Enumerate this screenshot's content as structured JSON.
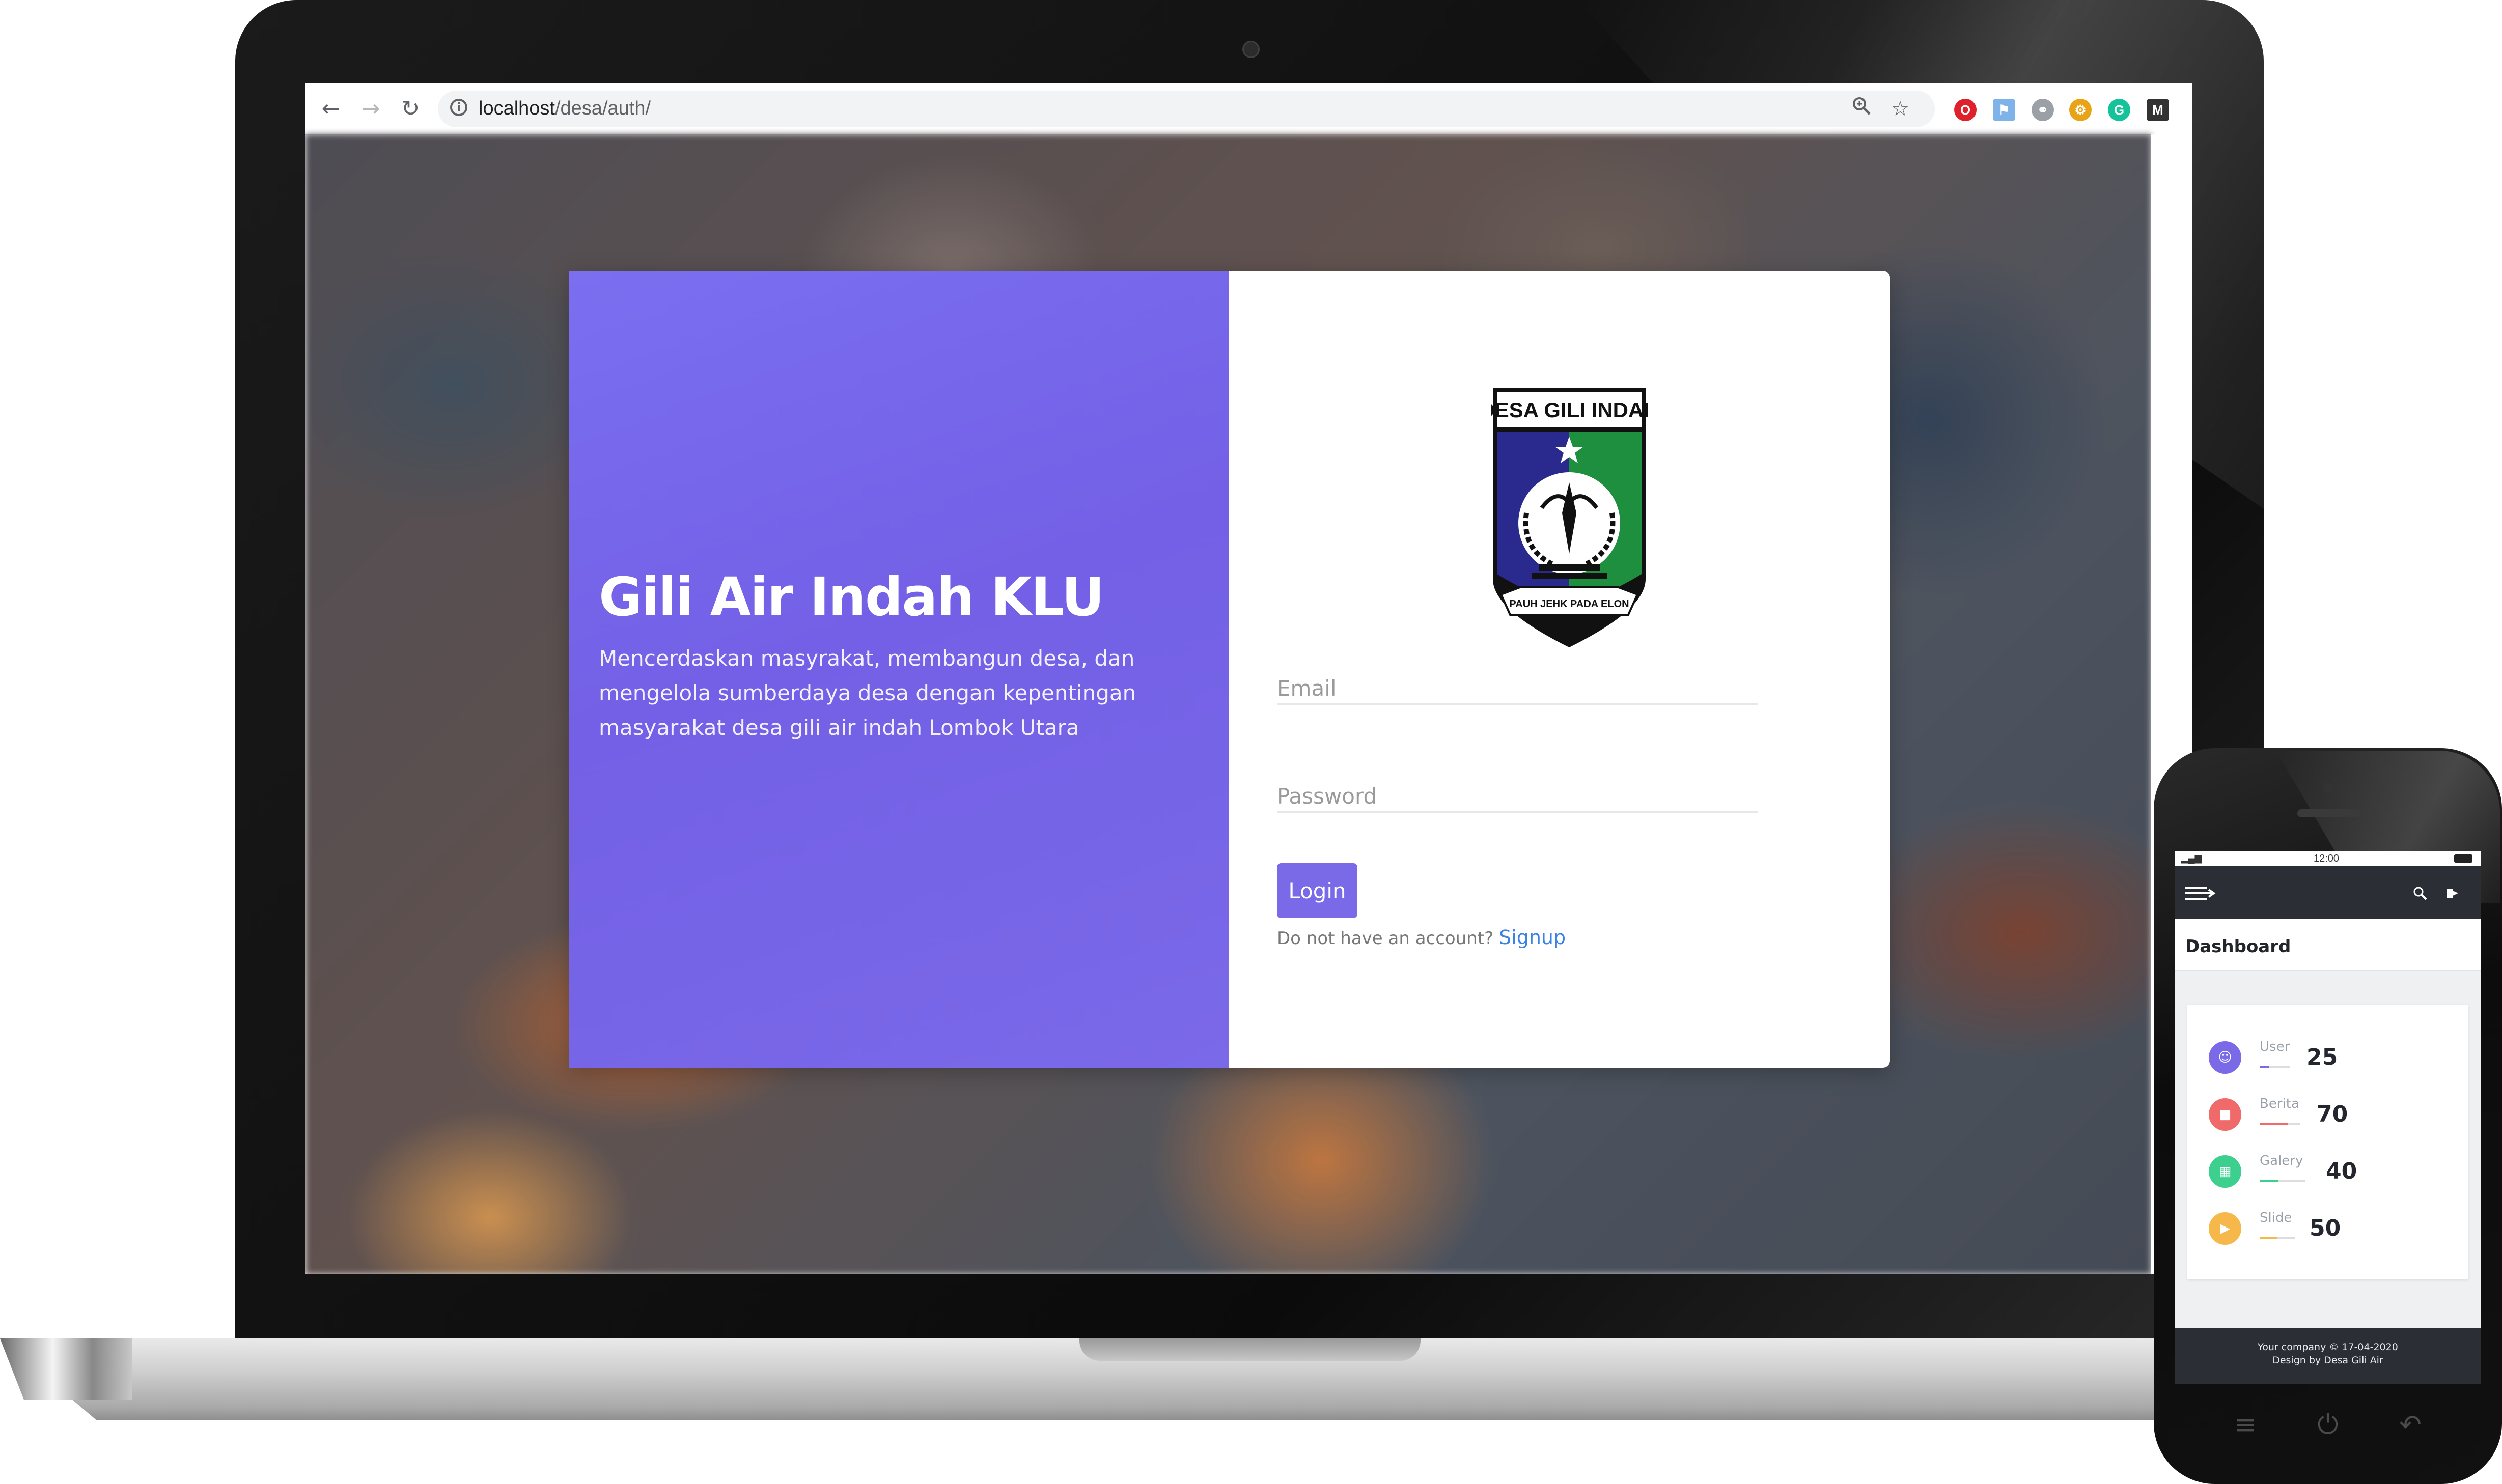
{
  "browser": {
    "url_host": "localhost",
    "url_path": "/desa/auth/",
    "icons": [
      "back-icon",
      "forward-icon",
      "reload-icon",
      "info-icon",
      "zoom-icon",
      "star-icon",
      "menu-dots-icon"
    ]
  },
  "login_page": {
    "title": "Gili Air Indah KLU",
    "description": "Mencerdaskan masyrakat, membangun desa, dan mengelola sumberdaya desa dengan kepentingan masyarakat desa gili air indah Lombok Utara",
    "logo_text": "DESA GILI INDAH",
    "logo_motto": "PAUH JEHK PADA ELON",
    "email_placeholder": "Email",
    "password_placeholder": "Password",
    "login_label": "Login",
    "no_account_text": "Do not have an account?",
    "signup_label": "Signup",
    "colors": {
      "accent": "#7a6ae8",
      "link": "#3b82e6"
    }
  },
  "phone": {
    "status_time": "12:00",
    "dashboard_title": "Dashboard",
    "stats": [
      {
        "label": "User",
        "value": "25",
        "color": "#7a6ae8"
      },
      {
        "label": "Berita",
        "value": "70",
        "color": "#f06a6a"
      },
      {
        "label": "Galery",
        "value": "40",
        "color": "#3ccf8e"
      },
      {
        "label": "Slide",
        "value": "50",
        "color": "#f7b84b"
      }
    ],
    "footer_line1": "Your company © 17-04-2020",
    "footer_line2": "Design by Desa Gili Air"
  }
}
